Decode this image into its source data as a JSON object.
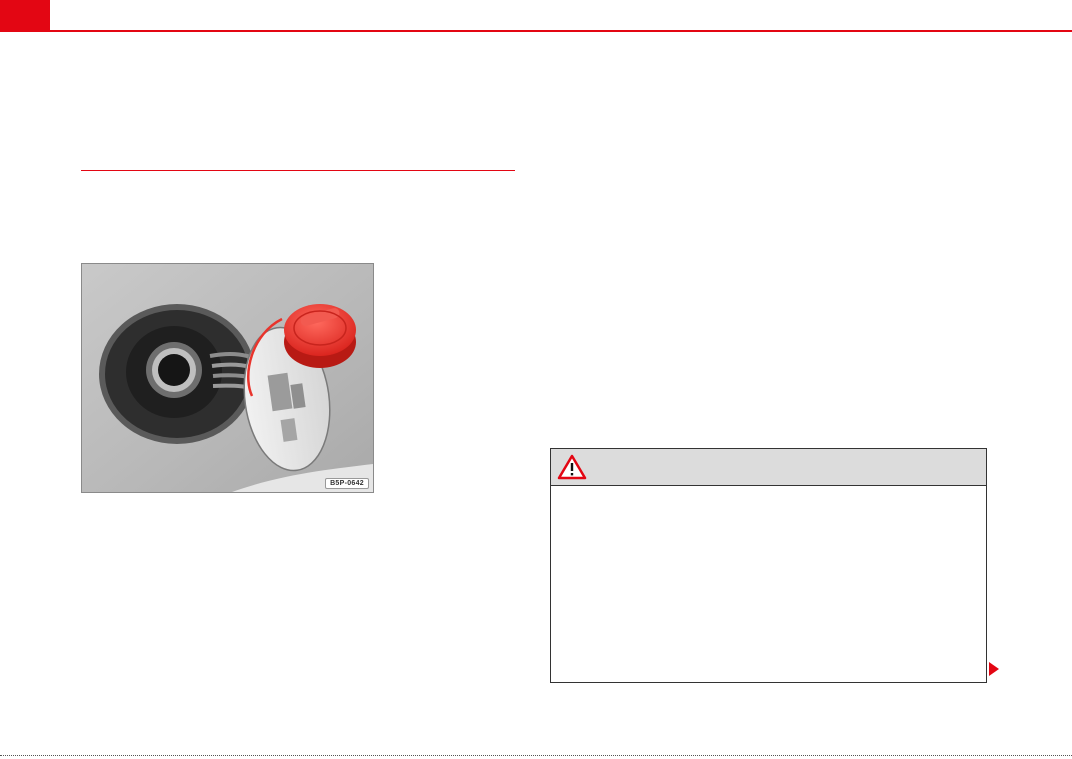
{
  "figure": {
    "image_id": "B5P-0642",
    "icon": "fuel-filler-cap-illustration"
  },
  "warning": {
    "icon": "warning-triangle-icon"
  },
  "navigation": {
    "continue_icon": "continue-arrow-icon"
  },
  "colors": {
    "accent": "#e30613",
    "cap_red": "#e8342c",
    "warning_header_bg": "#dcdcdc"
  }
}
